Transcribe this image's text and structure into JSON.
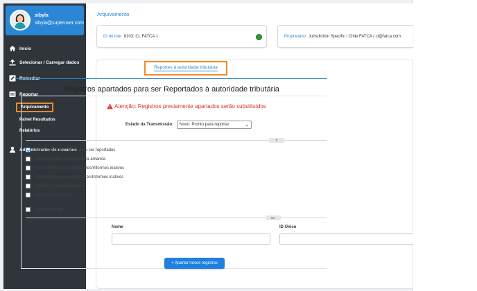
{
  "profile": {
    "name": "sibyla",
    "email": "sibyla@superuser.com"
  },
  "sidebar": {
    "items": [
      {
        "label": "Início",
        "icon": "home-icon"
      },
      {
        "label": "Selecionar / Carregar dados",
        "icon": "upload-icon"
      },
      {
        "label": "Remediar",
        "icon": "edit-icon"
      },
      {
        "label": "Reportar",
        "icon": "report-icon"
      },
      {
        "label": "Administrador de usuários",
        "icon": "user-icon"
      }
    ],
    "subitems": [
      {
        "label": "Arquivamento",
        "active": true
      },
      {
        "label": "Painel Resultados"
      },
      {
        "label": "Relatórios"
      }
    ]
  },
  "breadcrumb": "Arquivamento",
  "lote": {
    "label": "ID do lote",
    "value": "8103: CL FATCA 1"
  },
  "proprietario": {
    "label": "Proprietário",
    "value": "Jurisdiction Specific / Chile FATCA / cl@fatca.com"
  },
  "tab": "Reportes à autoridade tributária",
  "heading": "Registros apartados para ser Reportados à autoridade tributária",
  "warning": "Atenção: Registros previamente apartados serão substituídos",
  "estado": {
    "label": "Estado da Transmissão:",
    "selected": "Novo: Pronto para reportar"
  },
  "dividers": {
    "first": "E",
    "second": "OU"
  },
  "checkboxes": [
    {
      "label": "Incluir registros prontos para ser reportados",
      "checked": true
    },
    {
      "label": "Incluir registros com bandeira amarela",
      "checked": false
    },
    {
      "label": "Incluir indivíduos recalcitrantes/Informes inativos",
      "checked": false
    },
    {
      "label": "Incluir entidades recalcitrantes/Informes inativos",
      "checked": false
    },
    {
      "label": "Incluir FFI não participantes",
      "checked": false
    },
    {
      "label": "Incluir Informe Nulo",
      "checked": false
    }
  ],
  "select_all": {
    "label": "Selecionar tudo",
    "checked": false
  },
  "fields": {
    "nome_label": "Nome",
    "id_label": "ID Único"
  },
  "button": "+ Apartar novos registros",
  "colors": {
    "accent": "#2b86d6",
    "highlight": "#f08a24",
    "warning": "#d9322e",
    "sidebar": "#2f353b",
    "status": "#2e9c3a"
  }
}
